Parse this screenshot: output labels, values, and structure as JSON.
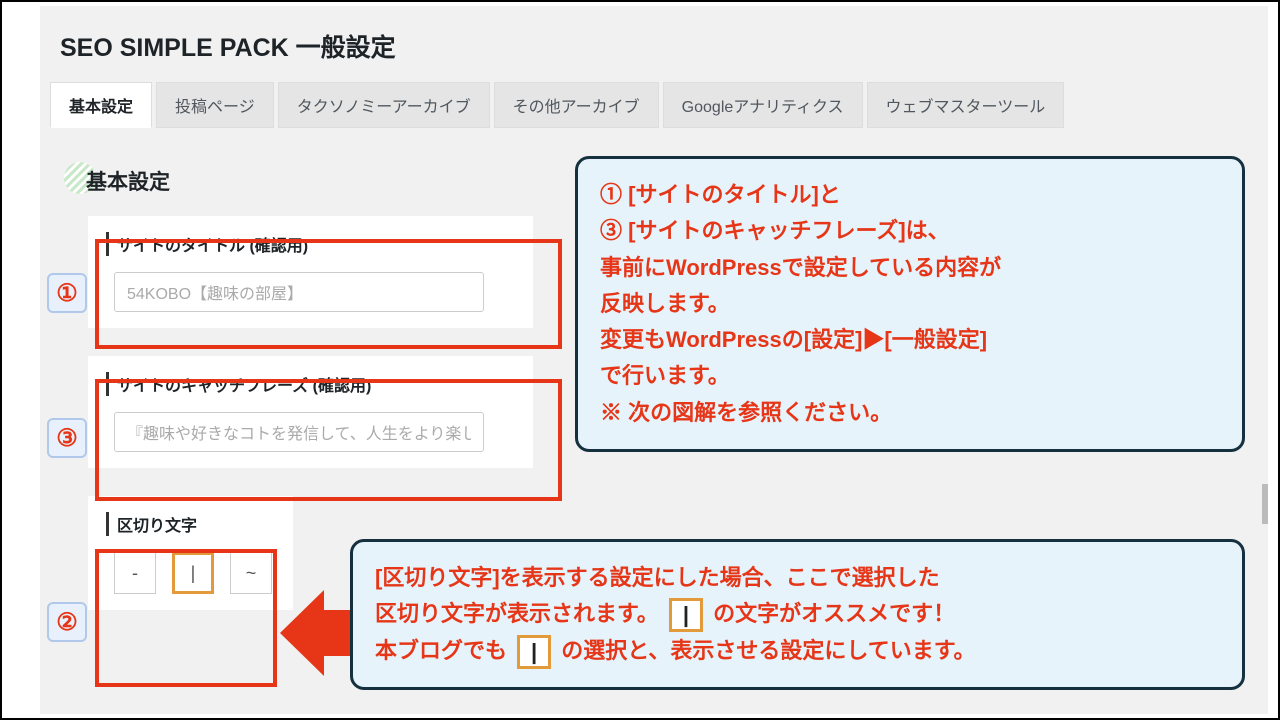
{
  "page_title": "SEO SIMPLE PACK 一般設定",
  "tabs": [
    {
      "label": "基本設定",
      "active": true
    },
    {
      "label": "投稿ページ",
      "active": false
    },
    {
      "label": "タクソノミーアーカイブ",
      "active": false
    },
    {
      "label": "その他アーカイブ",
      "active": false
    },
    {
      "label": "Googleアナリティクス",
      "active": false
    },
    {
      "label": "ウェブマスターツール",
      "active": false
    }
  ],
  "section_heading": "基本設定",
  "fields": {
    "site_title": {
      "label": "サイトのタイトル (確認用)",
      "value": "54KOBO【趣味の部屋】"
    },
    "catchphrase": {
      "label": "サイトのキャッチフレーズ (確認用)",
      "value": "『趣味や好きなコトを発信して、人生をより楽し."
    },
    "separator": {
      "label": "区切り文字",
      "options": [
        "-",
        "|",
        "~"
      ],
      "selected_index": 1
    }
  },
  "badges": {
    "one": "①",
    "two": "②",
    "three": "③"
  },
  "callout_top": {
    "line1": "① [サイトのタイトル]と",
    "line2": "③ [サイトのキャッチフレーズ]は、",
    "line3": "事前にWordPressで設定している内容が",
    "line4": "反映します。",
    "line5": "変更もWordPressの[設定]▶[一般設定]",
    "line6": "で行います。",
    "line7": "※ 次の図解を参照ください。"
  },
  "callout_bottom": {
    "line1_a": "[区切り文字]を表示する設定にした場合、ここで選択した",
    "line2_a": "区切り文字が表示されます。",
    "line2_b": " の文字がオススメです！",
    "line3_a": "本ブログでも ",
    "line3_b": " の選択と、表示させる設定にしています。",
    "pipe": "|"
  }
}
